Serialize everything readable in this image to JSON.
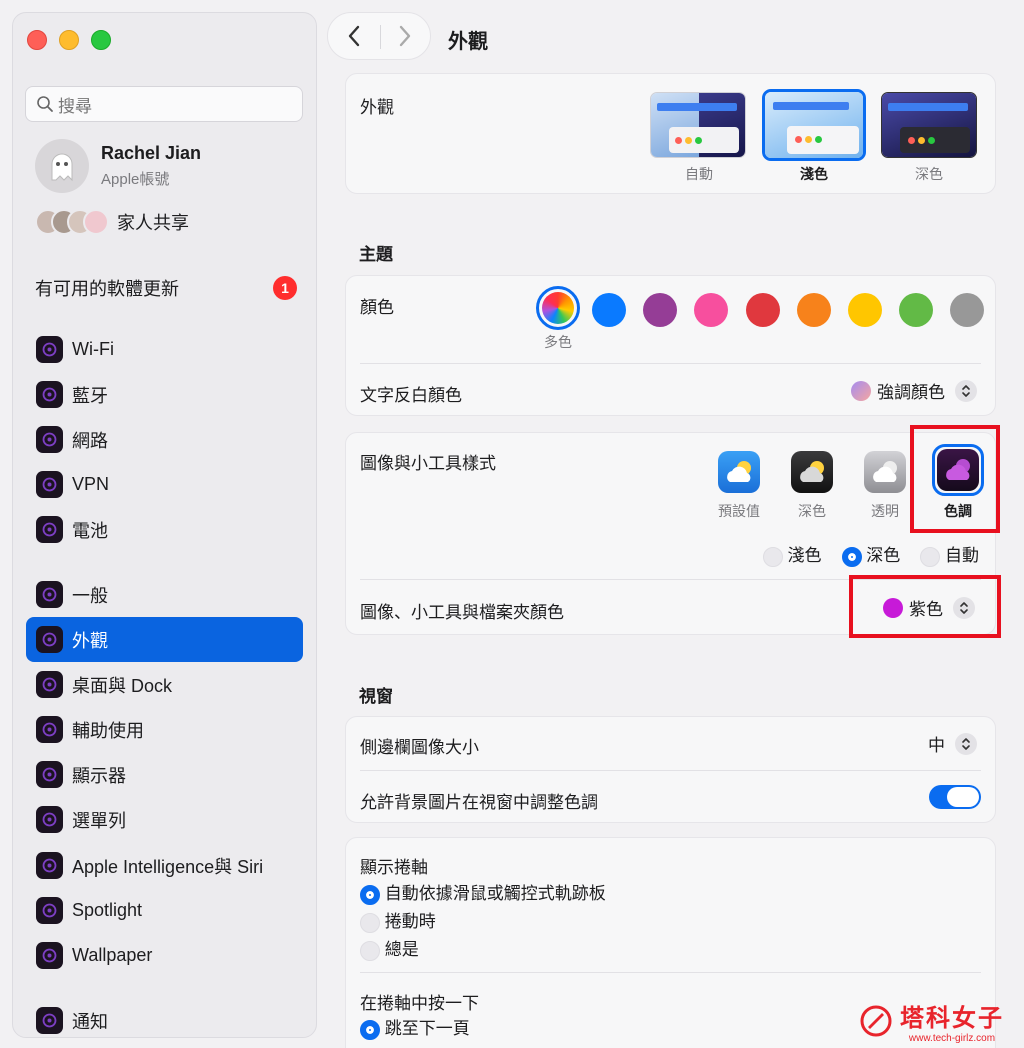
{
  "sidebar": {
    "search_placeholder": "搜尋",
    "account": {
      "name": "Rachel Jian",
      "subtitle": "Apple帳號"
    },
    "family": "家人共享",
    "update": {
      "label": "有可用的軟體更新",
      "count": "1"
    },
    "items": [
      {
        "label": "Wi-Fi",
        "icon": "wifi-icon"
      },
      {
        "label": "藍牙",
        "icon": "bluetooth-icon"
      },
      {
        "label": "網路",
        "icon": "globe-icon"
      },
      {
        "label": "VPN",
        "icon": "vpn-globe-icon"
      },
      {
        "label": "電池",
        "icon": "battery-icon"
      },
      {
        "label": "一般",
        "icon": "gear-icon"
      },
      {
        "label": "外觀",
        "icon": "appearance-icon",
        "active": true
      },
      {
        "label": "桌面與 Dock",
        "icon": "desktop-dock-icon"
      },
      {
        "label": "輔助使用",
        "icon": "accessibility-icon"
      },
      {
        "label": "顯示器",
        "icon": "display-icon"
      },
      {
        "label": "選單列",
        "icon": "menubar-icon"
      },
      {
        "label": "Apple Intelligence與 Siri",
        "icon": "siri-icon"
      },
      {
        "label": "Spotlight",
        "icon": "spotlight-icon"
      },
      {
        "label": "Wallpaper",
        "icon": "wallpaper-icon"
      },
      {
        "label": "通知",
        "icon": "notification-bell-icon"
      }
    ]
  },
  "header": {
    "title": "外觀"
  },
  "appearance": {
    "label": "外觀",
    "options": [
      {
        "label": "自動"
      },
      {
        "label": "淺色",
        "selected": true
      },
      {
        "label": "深色"
      }
    ]
  },
  "theme": {
    "section_title": "主題",
    "color_label": "顏色",
    "selected_color_label": "多色",
    "colors": [
      "#0a7aff",
      "#953d96",
      "#f74f9e",
      "#e0383e",
      "#f7821b",
      "#ffc600",
      "#62ba46",
      "#989898"
    ],
    "highlight_label": "文字反白顏色",
    "highlight_value": "強調顏色"
  },
  "widgets": {
    "style_label": "圖像與小工具樣式",
    "styles": [
      {
        "label": "預設值"
      },
      {
        "label": "深色"
      },
      {
        "label": "透明"
      },
      {
        "label": "色調",
        "selected": true
      }
    ],
    "modes": [
      {
        "label": "淺色",
        "selected": false
      },
      {
        "label": "深色",
        "selected": true
      },
      {
        "label": "自動",
        "selected": false
      }
    ],
    "folder_color_label": "圖像、小工具與檔案夾顏色",
    "folder_color_value": "紫色",
    "folder_color_hex": "#c71ad8"
  },
  "window": {
    "section_title": "視窗",
    "sidebar_icon_label": "側邊欄圖像大小",
    "sidebar_icon_value": "中",
    "tint_label": "允許背景圖片在視窗中調整色調",
    "tint_on": true
  },
  "scroll": {
    "show_label": "顯示捲軸",
    "show_options": [
      {
        "label": "自動依據滑鼠或觸控式軌跡板",
        "selected": true
      },
      {
        "label": "捲動時",
        "selected": false
      },
      {
        "label": "總是",
        "selected": false
      }
    ],
    "click_label": "在捲軸中按一下",
    "click_options": [
      {
        "label": "跳至下一頁",
        "selected": true
      }
    ]
  },
  "watermark": {
    "text": "塔科女子",
    "url": "www.tech-girlz.com"
  }
}
